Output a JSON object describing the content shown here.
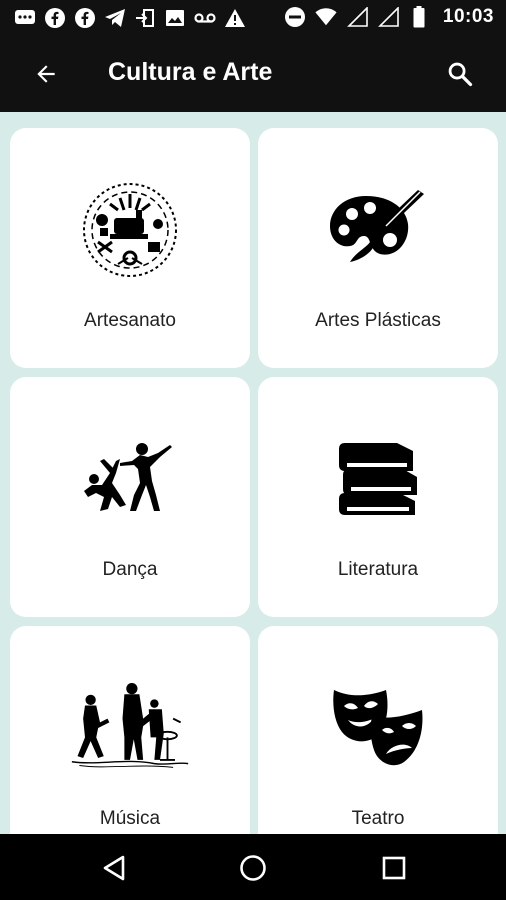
{
  "status_bar": {
    "time": "10:03",
    "left_icons": [
      "messages-icon",
      "facebook-icon",
      "facebook-icon",
      "telegram-icon",
      "sign-in-icon",
      "image-icon",
      "voicemail-icon",
      "warning-icon"
    ],
    "right_icons": [
      "dnd-icon",
      "wifi-icon",
      "signal-icon",
      "signal-icon",
      "battery-icon"
    ]
  },
  "app_bar": {
    "title": "Cultura e Arte",
    "back_icon": "arrow-back-icon",
    "search_icon": "search-icon"
  },
  "categories": [
    {
      "label": "Artesanato",
      "icon": "crafts-icon"
    },
    {
      "label": "Artes Plásticas",
      "icon": "palette-icon"
    },
    {
      "label": "Dança",
      "icon": "dancers-icon"
    },
    {
      "label": "Literatura",
      "icon": "books-icon"
    },
    {
      "label": "Música",
      "icon": "band-icon"
    },
    {
      "label": "Teatro",
      "icon": "theater-masks-icon"
    }
  ],
  "nav_bar": {
    "buttons": [
      "back-triangle-icon",
      "home-circle-icon",
      "recents-square-icon"
    ]
  },
  "colors": {
    "bar": "#111111",
    "background": "#d7ebe9",
    "card": "#ffffff"
  }
}
